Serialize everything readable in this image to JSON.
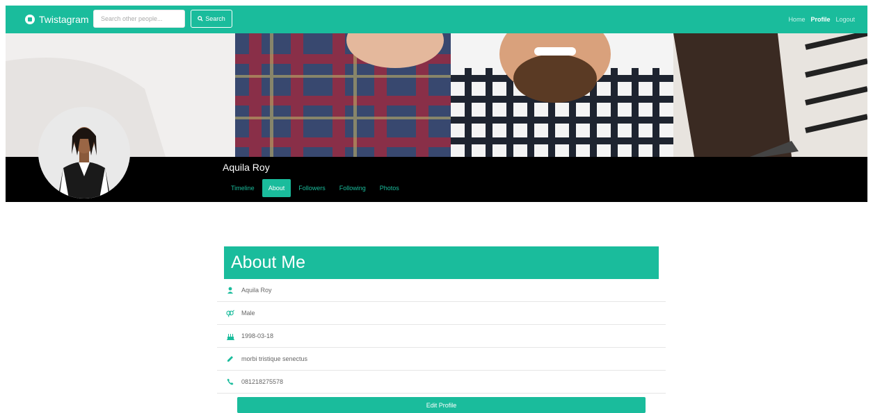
{
  "navbar": {
    "brand": "Twistagram",
    "search_placeholder": "Search other people...",
    "search_button": "Search",
    "links": [
      {
        "label": "Home",
        "active": false
      },
      {
        "label": "Profile",
        "active": true
      },
      {
        "label": "Logout",
        "active": false
      }
    ]
  },
  "profile": {
    "name": "Aquila Roy",
    "tabs": [
      {
        "label": "Timeline",
        "active": false
      },
      {
        "label": "About",
        "active": true
      },
      {
        "label": "Followers",
        "active": false
      },
      {
        "label": "Following",
        "active": false
      },
      {
        "label": "Photos",
        "active": false
      }
    ]
  },
  "about": {
    "title": "About Me",
    "rows": [
      {
        "icon": "user-icon",
        "value": "Aquila Roy"
      },
      {
        "icon": "gender-icon",
        "value": "Male"
      },
      {
        "icon": "birthday-cake-icon",
        "value": "1998-03-18"
      },
      {
        "icon": "pencil-icon",
        "value": "morbi tristique senectus"
      },
      {
        "icon": "phone-icon",
        "value": "081218275578"
      }
    ],
    "edit_button": "Edit Profile"
  },
  "colors": {
    "accent": "#1abc9c",
    "profile_bar": "#000000"
  }
}
